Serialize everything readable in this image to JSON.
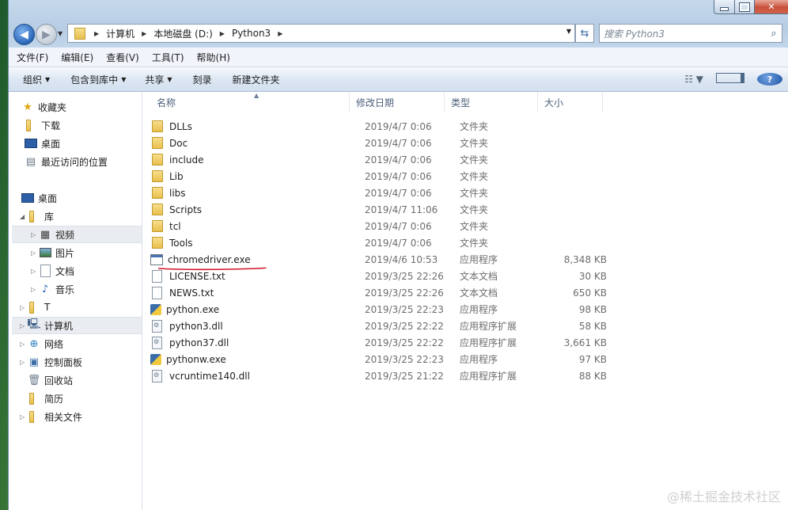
{
  "address": {
    "segments": [
      "计算机",
      "本地磁盘 (D:)",
      "Python3"
    ]
  },
  "search": {
    "placeholder": "搜索 Python3"
  },
  "menu": [
    "文件(F)",
    "编辑(E)",
    "查看(V)",
    "工具(T)",
    "帮助(H)"
  ],
  "commands": {
    "organize": "组织",
    "include_in_library": "包含到库中",
    "share": "共享",
    "burn": "刻录",
    "new_folder": "新建文件夹"
  },
  "nav": {
    "favorites": "收藏夹",
    "downloads": "下载",
    "desktop_fav": "桌面",
    "recent": "最近访问的位置",
    "desktop": "桌面",
    "libraries": "库",
    "videos": "视频",
    "pictures": "图片",
    "documents": "文档",
    "music": "音乐",
    "t_drive": "T",
    "computer": "计算机",
    "network": "网络",
    "control_panel": "控制面板",
    "recycle_bin": "回收站",
    "resume": "简历",
    "related_docs": "相关文件"
  },
  "columns": {
    "name": "名称",
    "date": "修改日期",
    "type": "类型",
    "size": "大小"
  },
  "files": [
    {
      "name": "DLLs",
      "date": "2019/4/7 0:06",
      "type": "文件夹",
      "size": "",
      "icon": "folder-icon"
    },
    {
      "name": "Doc",
      "date": "2019/4/7 0:06",
      "type": "文件夹",
      "size": "",
      "icon": "folder-icon"
    },
    {
      "name": "include",
      "date": "2019/4/7 0:06",
      "type": "文件夹",
      "size": "",
      "icon": "folder-icon"
    },
    {
      "name": "Lib",
      "date": "2019/4/7 0:06",
      "type": "文件夹",
      "size": "",
      "icon": "folder-icon"
    },
    {
      "name": "libs",
      "date": "2019/4/7 0:06",
      "type": "文件夹",
      "size": "",
      "icon": "folder-icon"
    },
    {
      "name": "Scripts",
      "date": "2019/4/7 11:06",
      "type": "文件夹",
      "size": "",
      "icon": "folder-icon"
    },
    {
      "name": "tcl",
      "date": "2019/4/7 0:06",
      "type": "文件夹",
      "size": "",
      "icon": "folder-icon"
    },
    {
      "name": "Tools",
      "date": "2019/4/7 0:06",
      "type": "文件夹",
      "size": "",
      "icon": "folder-icon"
    },
    {
      "name": "chromedriver.exe",
      "date": "2019/4/6 10:53",
      "type": "应用程序",
      "size": "8,348 KB",
      "icon": "exe-icon"
    },
    {
      "name": "LICENSE.txt",
      "date": "2019/3/25 22:26",
      "type": "文本文档",
      "size": "30 KB",
      "icon": "text-file-icon"
    },
    {
      "name": "NEWS.txt",
      "date": "2019/3/25 22:26",
      "type": "文本文档",
      "size": "650 KB",
      "icon": "text-file-icon"
    },
    {
      "name": "python.exe",
      "date": "2019/3/25 22:23",
      "type": "应用程序",
      "size": "98 KB",
      "icon": "python-icon"
    },
    {
      "name": "python3.dll",
      "date": "2019/3/25 22:22",
      "type": "应用程序扩展",
      "size": "58 KB",
      "icon": "dll-icon"
    },
    {
      "name": "python37.dll",
      "date": "2019/3/25 22:22",
      "type": "应用程序扩展",
      "size": "3,661 KB",
      "icon": "dll-icon"
    },
    {
      "name": "pythonw.exe",
      "date": "2019/3/25 22:23",
      "type": "应用程序",
      "size": "97 KB",
      "icon": "python-icon"
    },
    {
      "name": "vcruntime140.dll",
      "date": "2019/3/25 21:22",
      "type": "应用程序扩展",
      "size": "88 KB",
      "icon": "dll-icon"
    }
  ],
  "watermark": "@稀土掘金技术社区",
  "colors": {
    "annotation_red": "#d0142a",
    "accent": "#2a66b8"
  }
}
